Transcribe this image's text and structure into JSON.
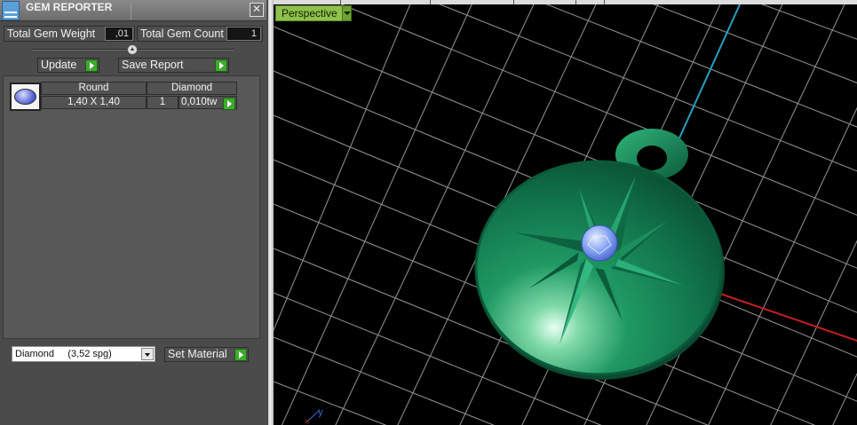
{
  "panel": {
    "title": "GEM REPORTER",
    "close_glyph": "✕",
    "total_weight_label": "Total Gem Weight",
    "total_weight_value": ",01",
    "total_count_label": "Total Gem Count",
    "total_count_value": "1",
    "update_label": "Update",
    "save_report_label": "Save Report",
    "gem_rows": [
      {
        "shape": "Round",
        "type": "Diamond",
        "size": "1,40 X 1,40",
        "count": "1",
        "weight": "0,010tw"
      }
    ],
    "material_selected": "Diamond     (3,52 spg)",
    "set_material_label": "Set Material"
  },
  "viewport": {
    "view_mode": "Perspective",
    "axis_label": "y"
  },
  "colors": {
    "pendant_green": "#1e8a5a",
    "grid": "#8a8a8a",
    "view_label_bg": "#8fc04c",
    "go_button": "#3faa2f",
    "x_axis": "#c02020",
    "y_axis": "#2aa0c0"
  },
  "icons": [
    "app-icon",
    "close-icon",
    "slider-knob-icon",
    "gem-thumbnail-icon",
    "dropdown-arrow-icon",
    "go-arrow-icon"
  ]
}
